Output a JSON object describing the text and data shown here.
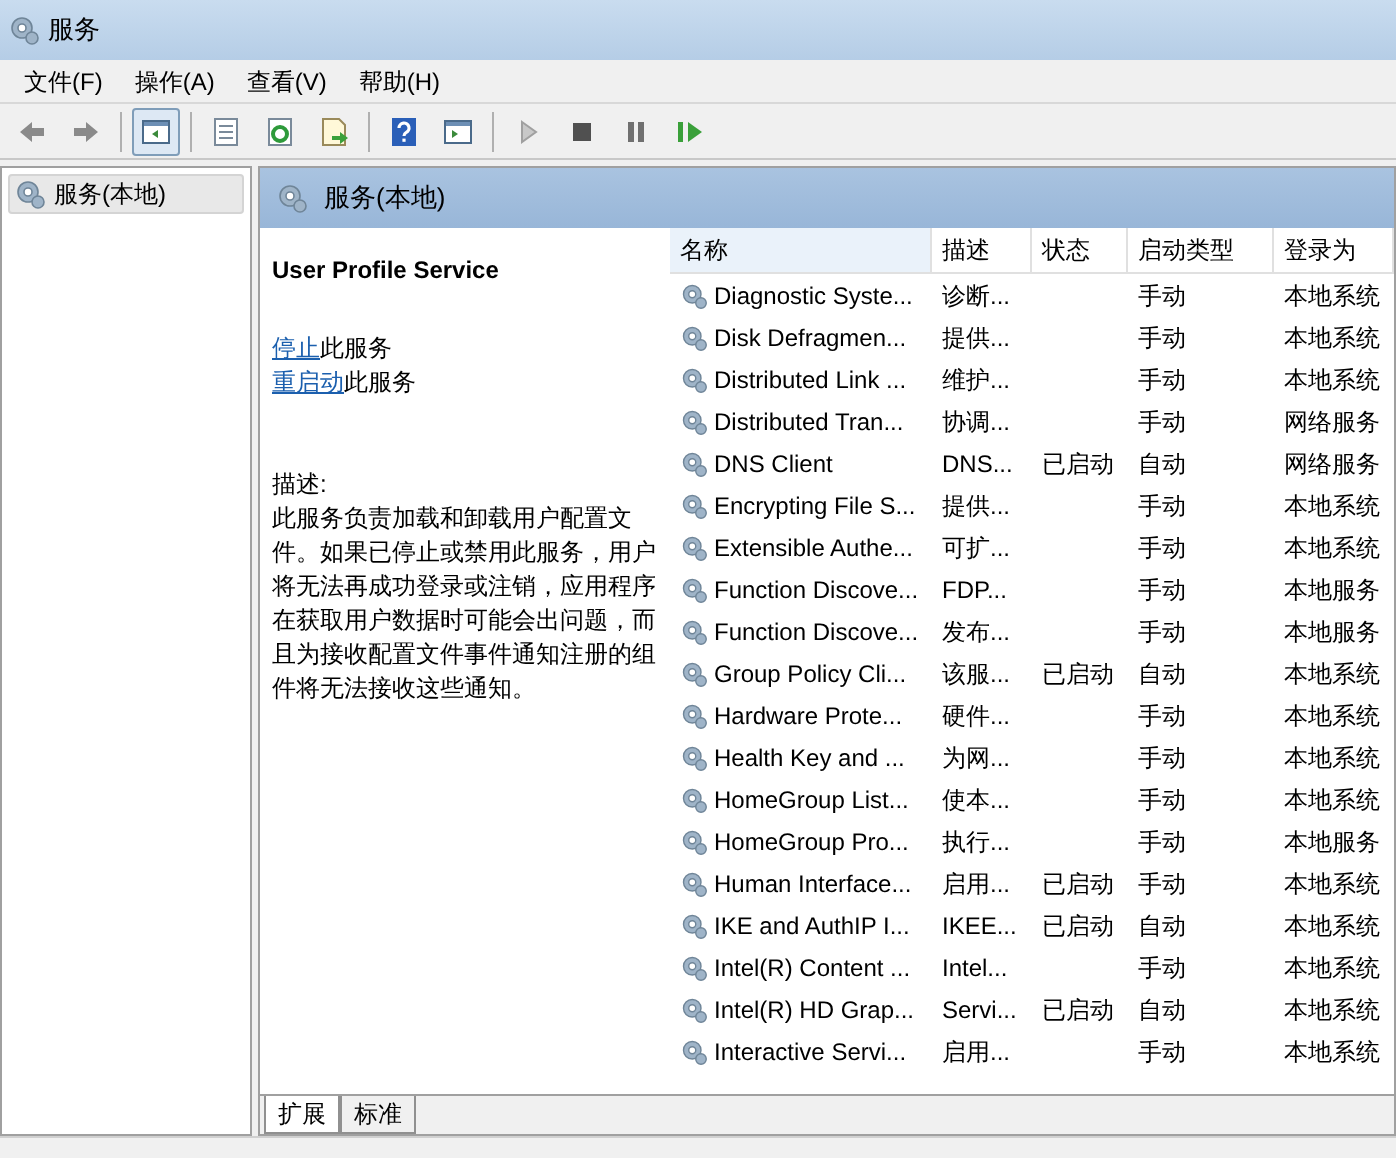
{
  "window": {
    "title": "服务"
  },
  "menu": [
    "文件(F)",
    "操作(A)",
    "查看(V)",
    "帮助(H)"
  ],
  "toolbar": [
    {
      "kind": "back",
      "selected": false
    },
    {
      "kind": "forward",
      "selected": false
    },
    {
      "kind": "sep"
    },
    {
      "kind": "tree",
      "selected": true
    },
    {
      "kind": "sep"
    },
    {
      "kind": "properties",
      "selected": false
    },
    {
      "kind": "refresh",
      "selected": false
    },
    {
      "kind": "export",
      "selected": false
    },
    {
      "kind": "sep"
    },
    {
      "kind": "help",
      "selected": false
    },
    {
      "kind": "panel",
      "selected": false
    },
    {
      "kind": "sep"
    },
    {
      "kind": "play",
      "selected": false
    },
    {
      "kind": "stop",
      "selected": false
    },
    {
      "kind": "pause",
      "selected": false
    },
    {
      "kind": "resume",
      "selected": false
    }
  ],
  "tree": [
    {
      "label": "服务(本地)",
      "selected": true
    }
  ],
  "panel_header": "服务(本地)",
  "details": {
    "title": "User Profile Service",
    "actions": [
      {
        "link": "停止",
        "text": "此服务"
      },
      {
        "link": "重启动",
        "text": "此服务"
      }
    ],
    "description_label": "描述:",
    "description": "此服务负责加载和卸载用户配置文件。如果已停止或禁用此服务，用户将无法再成功登录或注销，应用程序在获取用户数据时可能会出问题，而且为接收配置文件事件通知注册的组件将无法接收这些通知。"
  },
  "table": {
    "columns": [
      "名称",
      "描述",
      "状态",
      "启动类型",
      "登录为"
    ],
    "rows": [
      [
        "Diagnostic Syste...",
        "诊断...",
        "",
        "手动",
        "本地系统"
      ],
      [
        "Disk Defragmen...",
        "提供...",
        "",
        "手动",
        "本地系统"
      ],
      [
        "Distributed Link ...",
        "维护...",
        "",
        "手动",
        "本地系统"
      ],
      [
        "Distributed Tran...",
        "协调...",
        "",
        "手动",
        "网络服务"
      ],
      [
        "DNS Client",
        "DNS...",
        "已启动",
        "自动",
        "网络服务"
      ],
      [
        "Encrypting File S...",
        "提供...",
        "",
        "手动",
        "本地系统"
      ],
      [
        "Extensible Authe...",
        "可扩...",
        "",
        "手动",
        "本地系统"
      ],
      [
        "Function Discove...",
        "FDP...",
        "",
        "手动",
        "本地服务"
      ],
      [
        "Function Discove...",
        "发布...",
        "",
        "手动",
        "本地服务"
      ],
      [
        "Group Policy Cli...",
        "该服...",
        "已启动",
        "自动",
        "本地系统"
      ],
      [
        "Hardware Prote...",
        "硬件...",
        "",
        "手动",
        "本地系统"
      ],
      [
        "Health Key and ...",
        "为网...",
        "",
        "手动",
        "本地系统"
      ],
      [
        "HomeGroup List...",
        "使本...",
        "",
        "手动",
        "本地系统"
      ],
      [
        "HomeGroup Pro...",
        "执行...",
        "",
        "手动",
        "本地服务"
      ],
      [
        "Human Interface...",
        "启用...",
        "已启动",
        "手动",
        "本地系统"
      ],
      [
        "IKE and AuthIP I...",
        "IKEE...",
        "已启动",
        "自动",
        "本地系统"
      ],
      [
        "Intel(R) Content ...",
        "Intel...",
        "",
        "手动",
        "本地系统"
      ],
      [
        "Intel(R) HD Grap...",
        "Servi...",
        "已启动",
        "自动",
        "本地系统"
      ],
      [
        "Interactive Servi...",
        "启用...",
        "",
        "手动",
        "本地系统"
      ]
    ]
  },
  "tabs": [
    {
      "label": "扩展",
      "selected": true
    },
    {
      "label": "标准",
      "selected": false
    }
  ]
}
